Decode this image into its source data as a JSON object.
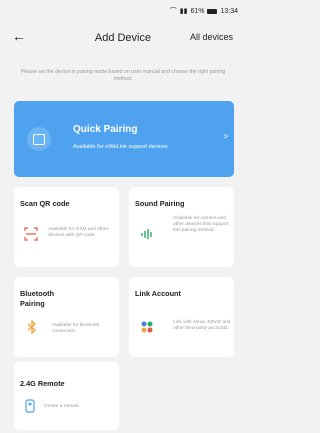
{
  "status_bar": {
    "text": "61%",
    "time": "13:34",
    "signal": "☰"
  },
  "header": {
    "back": "←",
    "title": "Add Device",
    "right_link": "All devices"
  },
  "instructions": "Please set the device in pairing mode based on user manual and choose the right pairing method.",
  "quick_pairing": {
    "title": "Quick Pairing",
    "subtitle": "Available for eWeLink support devices",
    "chevron": ">"
  },
  "cards": [
    {
      "title": "Scan QR code",
      "desc": "Available for GSM and other devices with QR code.",
      "icon": "qr-scan-icon",
      "color": "#e05a47"
    },
    {
      "title": "Sound Pairing",
      "desc": "Available for camera and other devices that support this pairing method.",
      "icon": "sound-wave-icon",
      "color": "#2aaa6a"
    },
    {
      "title": "Bluetooth Pairing",
      "desc": "Available for bluetooth connection.",
      "icon": "bluetooth-icon",
      "color": "#f0a43a"
    },
    {
      "title": "Link Account",
      "desc": "Link with Alexa, EZVIZ and other third-party accounts.",
      "icon": "link-account-icon",
      "color": "#4f7bd9"
    },
    {
      "title": "2.4G Remote",
      "desc": "Create a remote.",
      "icon": "remote-icon",
      "color": "#4fa3ee"
    }
  ]
}
